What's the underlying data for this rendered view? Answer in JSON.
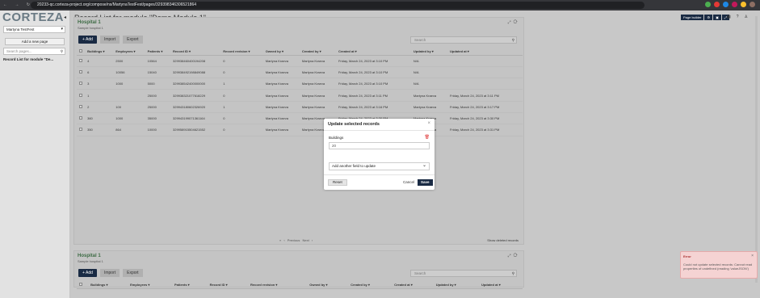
{
  "browser": {
    "nav": "← → ↻",
    "url": "20233-qc.corteza-project.org/compose/ns/MartynaTestFest/pages/329398346306521864"
  },
  "sidebar": {
    "logo": "CORTEZA",
    "namespace": "Martyna TestFest",
    "page_builder_button": "Add a new page",
    "search_placeholder": "Search pages...",
    "item": "Record List for module \"De..."
  },
  "header": {
    "title": "Record List for module \"Demo Module 1\"",
    "builder": [
      "Page builder",
      "⚙",
      "▣",
      "⤢"
    ]
  },
  "block1": {
    "title": "Hospital 1",
    "subtitle": "Sample hospital 1",
    "add": "+ Add",
    "import": "Import",
    "export": "Export",
    "search_placeholder": "Search",
    "columns": [
      "Buildings",
      "Employees",
      "Patients",
      "Record ID",
      "Record revision",
      "Owned by",
      "Created by",
      "Created at",
      "Updated by",
      "Updated at"
    ],
    "rows": [
      [
        "4",
        "2500",
        "10564",
        "329938460400194208",
        "0",
        "Martyna Kraeva",
        "Martyna Kraeva",
        "Friday, March 24, 2023 at 3:10 PM",
        "N/A",
        ""
      ],
      [
        "6",
        "10056",
        "15040",
        "329938492198849088",
        "0",
        "Martyna Kraeva",
        "Martyna Kraeva",
        "Friday, March 24, 2023 at 3:10 PM",
        "N/A",
        ""
      ],
      [
        "3",
        "1000",
        "5000",
        "329938542400000000",
        "1",
        "Martyna Kraeva",
        "Martyna Kraeva",
        "Friday, March 24, 2023 at 3:10 PM",
        "N/A",
        ""
      ],
      [
        "1",
        "",
        "25000",
        "329938321077618229",
        "0",
        "Martyna Kraeva",
        "Martyna Kraeva",
        "Friday, March 24, 2023 at 3:11 PM",
        "Martyna Kraeva",
        "Friday, March 24, 2023 at 3:11 PM"
      ],
      [
        "2",
        "100",
        "25000",
        "329943180602326920",
        "1",
        "Martyna Kraeva",
        "Martyna Kraeva",
        "Friday, March 24, 2023 at 3:16 PM",
        "Martyna Kraeva",
        "Friday, March 24, 2023 at 3:17 PM"
      ],
      [
        "360",
        "1000",
        "35000",
        "329943199071361164",
        "0",
        "Martyna Kraeva",
        "Martyna Kraeva",
        "Friday, March 24, 2023 at 3:30 PM",
        "Martyna Kraeva",
        "Friday, March 24, 2023 at 3:30 PM"
      ],
      [
        "350",
        "864",
        "10000",
        "329958915504621552",
        "0",
        "Martyna Kraeva",
        "Martyna Kraeva",
        "Friday, March 24, 2023 at 3:31 PM",
        "Martyna Kraeva",
        "Friday, March 24, 2023 at 3:31 PM"
      ]
    ],
    "pager": "« ‹ Previous Next ›",
    "show_deleted": "Show deleted records"
  },
  "block2": {
    "title": "Hospital 1",
    "subtitle": "Sample hospital 1",
    "add": "+ Add",
    "import": "Import",
    "export": "Export",
    "search_placeholder": "Search"
  },
  "modal": {
    "title": "Update selected records",
    "field_label": "Buildings",
    "field_value": "20",
    "add_field": "Add another field to update",
    "reset": "Reset",
    "cancel": "Cancel",
    "save": "Save"
  },
  "toast": {
    "title": "Error",
    "message": "Could not update selected records: Cannot read properties of undefined (reading 'valueJSON')"
  },
  "colors": {
    "accent": "#1a2b44",
    "title_green": "#3d6b44",
    "error_bg": "#f5d3d3"
  }
}
